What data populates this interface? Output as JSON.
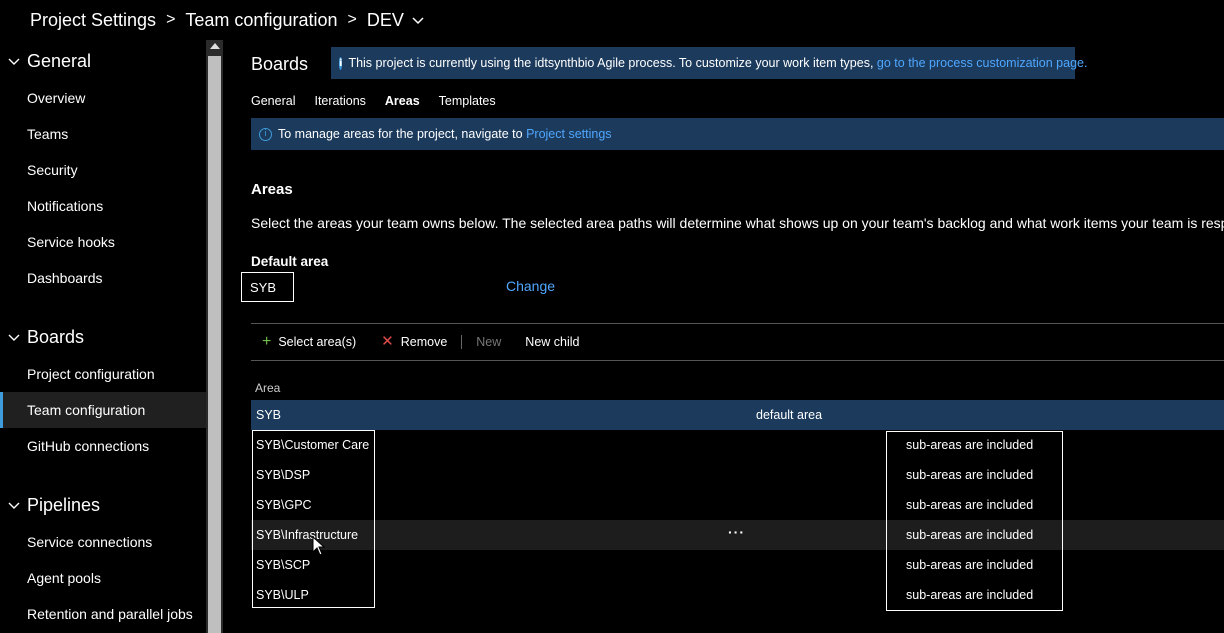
{
  "breadcrumb": {
    "items": [
      "Project Settings",
      "Team configuration",
      "DEV"
    ],
    "separator": ">"
  },
  "sidebar": {
    "sections": [
      {
        "title": "General",
        "items": [
          "Overview",
          "Teams",
          "Security",
          "Notifications",
          "Service hooks",
          "Dashboards"
        ]
      },
      {
        "title": "Boards",
        "items": [
          "Project configuration",
          "Team configuration",
          "GitHub connections"
        ]
      },
      {
        "title": "Pipelines",
        "items": [
          "Service connections",
          "Agent pools",
          "Retention and parallel jobs"
        ]
      }
    ],
    "selected": "Team configuration"
  },
  "main": {
    "title": "Boards",
    "process_banner": {
      "text": "This project is currently using the idtsynthbio Agile process. To customize your work item types,",
      "link": "go to the process customization page."
    },
    "tabs": [
      "General",
      "Iterations",
      "Areas",
      "Templates"
    ],
    "active_tab": "Areas",
    "areas_banner": {
      "text": "To manage areas for the project, navigate to",
      "link": "Project settings"
    },
    "areas_heading": "Areas",
    "description": "Select the areas your team owns below. The selected area paths will determine what shows up on your team's backlog and what work items your team is responsible for.",
    "default_area_heading": "Default area",
    "default_area_value": "SYB",
    "change_label": "Change",
    "toolbar": {
      "select": "Select area(s)",
      "remove": "Remove",
      "new": "New",
      "new_child": "New child"
    },
    "table": {
      "column_header": "Area",
      "rows": [
        {
          "name": "SYB",
          "note": "default area",
          "sub": ""
        },
        {
          "name": "SYB\\Customer Care",
          "note": "",
          "sub": "sub-areas are included"
        },
        {
          "name": "SYB\\DSP",
          "note": "",
          "sub": "sub-areas are included"
        },
        {
          "name": "SYB\\GPC",
          "note": "",
          "sub": "sub-areas are included"
        },
        {
          "name": "SYB\\Infrastructure",
          "note": "",
          "sub": "sub-areas are included"
        },
        {
          "name": "SYB\\SCP",
          "note": "",
          "sub": "sub-areas are included"
        },
        {
          "name": "SYB\\ULP",
          "note": "",
          "sub": "sub-areas are included"
        }
      ],
      "more_actions": "···"
    }
  },
  "colors": {
    "accent": "#3f9bd9",
    "link": "#4fa7ff",
    "banner_bg": "#1b3a5c",
    "selected_row": "#1b3a5c"
  }
}
